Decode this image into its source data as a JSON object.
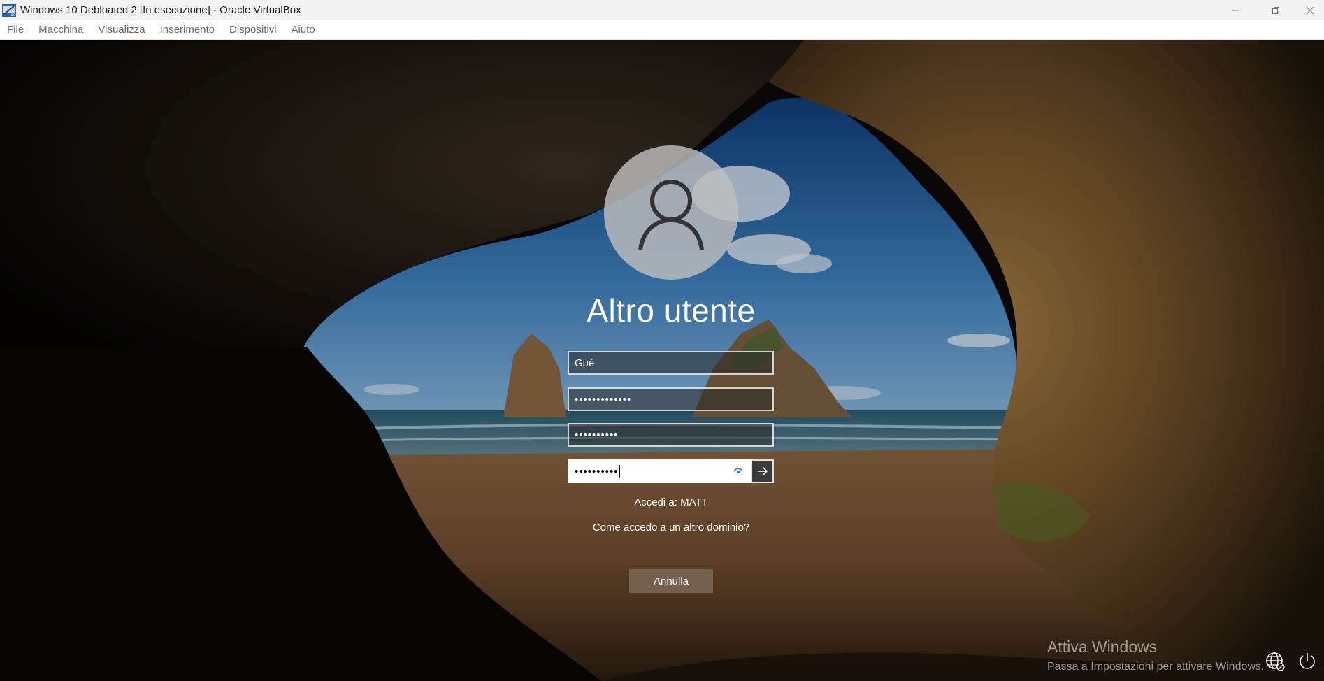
{
  "window": {
    "title": "Windows 10 Debloated 2 [In esecuzione] - Oracle VirtualBox",
    "icons": [
      "virtualbox-app-icon",
      "minimize-icon",
      "restore-icon",
      "close-icon"
    ]
  },
  "menubar": {
    "items": [
      "File",
      "Macchina",
      "Visualizza",
      "Inserimento",
      "Dispositivi",
      "Aiuto"
    ]
  },
  "login": {
    "user_title": "Altro utente",
    "username_value": "Guè",
    "password_field_1": "•••••••••••••",
    "password_field_2": "••••••••••",
    "password_field_3": "••••••••••",
    "signin_to": "Accedi a: MATT",
    "other_domain_link": "Come accedo a un altro dominio?",
    "cancel_label": "Annulla"
  },
  "watermark": {
    "title": "Attiva Windows",
    "subtitle": "Passa a Impostazioni per attivare Windows."
  },
  "tray": {
    "icons": [
      "network-icon",
      "power-icon"
    ]
  }
}
